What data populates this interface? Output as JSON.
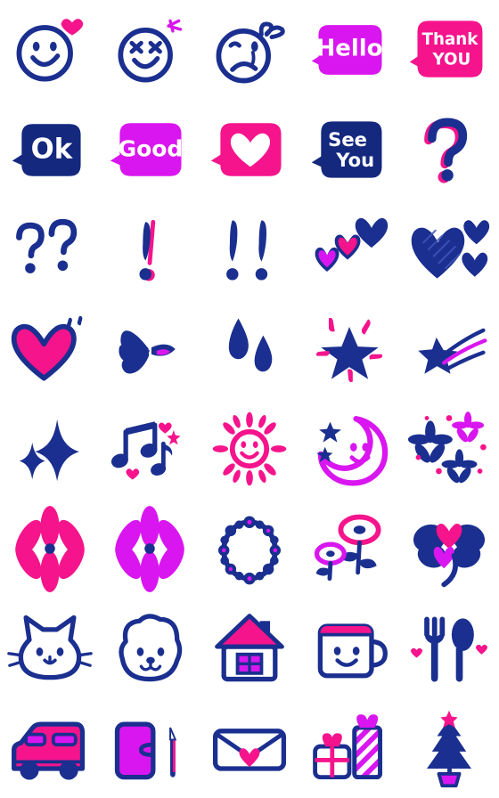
{
  "sheet": {
    "title": "Hand-drawn Emoji Sticker Sheet",
    "columns": 5,
    "rows": 8,
    "background_color": "#ffffff",
    "palette": {
      "navy": "#1a2f8f",
      "navy_dark": "#14287e",
      "magenta": "#d916ef",
      "pink": "#f5148c",
      "hot_pink": "#fa1f96",
      "white": "#ffffff"
    }
  },
  "stickers": [
    {
      "id": 1,
      "row": 1,
      "col": 1,
      "name": "smiley-face-with-heart",
      "label": "Smiley face with pink heart",
      "colors": [
        "#1a2f8f",
        "#f5148c"
      ],
      "text": ""
    },
    {
      "id": 2,
      "row": 1,
      "col": 2,
      "name": "happy-squint-face",
      "label": "Happy squinting face with sparkle",
      "colors": [
        "#1a2f8f",
        "#d916ef"
      ],
      "text": ""
    },
    {
      "id": 3,
      "row": 1,
      "col": 3,
      "name": "sad-face-with-bow",
      "label": "Sad crying face with bow",
      "colors": [
        "#1a2f8f"
      ],
      "text": ""
    },
    {
      "id": 4,
      "row": 1,
      "col": 4,
      "name": "speech-bubble-hello",
      "label": "Magenta speech bubble",
      "colors": [
        "#d916ef",
        "#ffffff"
      ],
      "text": "Hello"
    },
    {
      "id": 5,
      "row": 1,
      "col": 5,
      "name": "speech-bubble-thank-you",
      "label": "Pink speech bubble two lines",
      "colors": [
        "#f5148c",
        "#ffffff"
      ],
      "text": "Thank|YOU"
    },
    {
      "id": 6,
      "row": 2,
      "col": 1,
      "name": "speech-bubble-ok",
      "label": "Navy speech bubble",
      "colors": [
        "#14287e",
        "#ffffff"
      ],
      "text": "Ok"
    },
    {
      "id": 7,
      "row": 2,
      "col": 2,
      "name": "speech-bubble-good",
      "label": "Magenta speech bubble",
      "colors": [
        "#d916ef",
        "#ffffff"
      ],
      "text": "Good"
    },
    {
      "id": 8,
      "row": 2,
      "col": 3,
      "name": "speech-bubble-heart",
      "label": "Pink speech bubble with white heart",
      "colors": [
        "#f5148c",
        "#ffffff"
      ],
      "text": ""
    },
    {
      "id": 9,
      "row": 2,
      "col": 4,
      "name": "speech-bubble-see-you",
      "label": "Navy speech bubble two lines",
      "colors": [
        "#14287e",
        "#ffffff"
      ],
      "text": "See|You"
    },
    {
      "id": 10,
      "row": 2,
      "col": 5,
      "name": "question-mark",
      "label": "Question mark with pink shadow",
      "colors": [
        "#1a2f8f",
        "#f5148c"
      ],
      "text": "?"
    },
    {
      "id": 11,
      "row": 3,
      "col": 1,
      "name": "double-question-mark",
      "label": "Two question marks",
      "colors": [
        "#1a2f8f"
      ],
      "text": "??"
    },
    {
      "id": 12,
      "row": 3,
      "col": 2,
      "name": "exclamation-mark",
      "label": "Single exclamation mark",
      "colors": [
        "#1a2f8f",
        "#f5148c"
      ],
      "text": "!"
    },
    {
      "id": 13,
      "row": 3,
      "col": 3,
      "name": "double-exclamation-mark",
      "label": "Two exclamation marks",
      "colors": [
        "#1a2f8f"
      ],
      "text": "!!"
    },
    {
      "id": 14,
      "row": 3,
      "col": 4,
      "name": "three-ascending-hearts",
      "label": "Three hearts ascending",
      "colors": [
        "#1a2f8f",
        "#d916ef",
        "#f5148c"
      ],
      "text": ""
    },
    {
      "id": 15,
      "row": 3,
      "col": 5,
      "name": "striped-heart-trio",
      "label": "Large striped heart with two small",
      "colors": [
        "#1a2f8f"
      ],
      "text": ""
    },
    {
      "id": 16,
      "row": 4,
      "col": 1,
      "name": "pink-heart-outlined",
      "label": "Pink heart with navy outline",
      "colors": [
        "#1a2f8f",
        "#f5148c"
      ],
      "text": ""
    },
    {
      "id": 17,
      "row": 4,
      "col": 2,
      "name": "broken-heart",
      "label": "Broken heart",
      "colors": [
        "#1a2f8f",
        "#d916ef"
      ],
      "text": ""
    },
    {
      "id": 18,
      "row": 4,
      "col": 3,
      "name": "sweat-drops",
      "label": "Two sweat drops",
      "colors": [
        "#1a2f8f"
      ],
      "text": ""
    },
    {
      "id": 19,
      "row": 4,
      "col": 4,
      "name": "star-burst",
      "label": "Navy star with pink burst rays",
      "colors": [
        "#1a2f8f",
        "#f5148c"
      ],
      "text": ""
    },
    {
      "id": 20,
      "row": 4,
      "col": 5,
      "name": "shooting-star",
      "label": "Shooting star with trail",
      "colors": [
        "#1a2f8f",
        "#d916ef"
      ],
      "text": ""
    },
    {
      "id": 21,
      "row": 5,
      "col": 1,
      "name": "sparkles",
      "label": "Two four-point sparkles",
      "colors": [
        "#1a2f8f"
      ],
      "text": ""
    },
    {
      "id": 22,
      "row": 5,
      "col": 2,
      "name": "music-notes",
      "label": "Music notes with pink hearts",
      "colors": [
        "#1a2f8f",
        "#f5148c"
      ],
      "text": ""
    },
    {
      "id": 23,
      "row": 5,
      "col": 3,
      "name": "smiling-sun",
      "label": "Pink smiling sun with rays",
      "colors": [
        "#f5148c"
      ],
      "text": ""
    },
    {
      "id": 24,
      "row": 5,
      "col": 4,
      "name": "crescent-moon-with-stars",
      "label": "Magenta smiling crescent moon",
      "colors": [
        "#d916ef",
        "#1a2f8f"
      ],
      "text": ""
    },
    {
      "id": 25,
      "row": 5,
      "col": 5,
      "name": "flower-cluster",
      "label": "Cluster of small flowers",
      "colors": [
        "#1a2f8f",
        "#f5148c"
      ],
      "text": ""
    },
    {
      "id": 26,
      "row": 6,
      "col": 1,
      "name": "pink-flower",
      "label": "Pink six-petal flower",
      "colors": [
        "#f5148c",
        "#1a2f8f"
      ],
      "text": ""
    },
    {
      "id": 27,
      "row": 6,
      "col": 2,
      "name": "magenta-flower",
      "label": "Magenta six-petal flower",
      "colors": [
        "#d916ef",
        "#1a2f8f"
      ],
      "text": ""
    },
    {
      "id": 28,
      "row": 6,
      "col": 3,
      "name": "flower-wreath",
      "label": "Navy flower wreath ring",
      "colors": [
        "#1a2f8f"
      ],
      "text": ""
    },
    {
      "id": 29,
      "row": 6,
      "col": 4,
      "name": "tulip-flowers",
      "label": "Two outlined flowers",
      "colors": [
        "#1a2f8f",
        "#f5148c",
        "#d916ef"
      ],
      "text": ""
    },
    {
      "id": 30,
      "row": 6,
      "col": 5,
      "name": "four-leaf-clover",
      "label": "Clover with heart petals",
      "colors": [
        "#1a2f8f",
        "#f5148c",
        "#d916ef"
      ],
      "text": ""
    },
    {
      "id": 31,
      "row": 7,
      "col": 1,
      "name": "cat-face",
      "label": "White cat face",
      "colors": [
        "#1a2f8f",
        "#ffffff"
      ],
      "text": ""
    },
    {
      "id": 32,
      "row": 7,
      "col": 2,
      "name": "dog-face",
      "label": "White dog face",
      "colors": [
        "#1a2f8f",
        "#ffffff"
      ],
      "text": ""
    },
    {
      "id": 33,
      "row": 7,
      "col": 3,
      "name": "house",
      "label": "House with pink roof",
      "colors": [
        "#1a2f8f",
        "#f5148c",
        "#d916ef"
      ],
      "text": ""
    },
    {
      "id": 34,
      "row": 7,
      "col": 4,
      "name": "smiling-mug",
      "label": "Mug with smiling face",
      "colors": [
        "#1a2f8f",
        "#f5148c",
        "#ffffff"
      ],
      "text": ""
    },
    {
      "id": 35,
      "row": 7,
      "col": 5,
      "name": "fork-and-spoon",
      "label": "Fork and spoon with hearts",
      "colors": [
        "#1a2f8f",
        "#f5148c"
      ],
      "text": ""
    },
    {
      "id": 36,
      "row": 8,
      "col": 1,
      "name": "pink-car",
      "label": "Pink car with navy wheels",
      "colors": [
        "#f5148c",
        "#1a2f8f"
      ],
      "text": ""
    },
    {
      "id": 37,
      "row": 8,
      "col": 2,
      "name": "notebook-and-pen",
      "label": "Magenta notebook and pen",
      "colors": [
        "#d916ef",
        "#1a2f8f",
        "#f5148c"
      ],
      "text": ""
    },
    {
      "id": 38,
      "row": 8,
      "col": 3,
      "name": "envelope-with-heart",
      "label": "White envelope with pink heart",
      "colors": [
        "#1a2f8f",
        "#f5148c",
        "#ffffff"
      ],
      "text": ""
    },
    {
      "id": 39,
      "row": 8,
      "col": 4,
      "name": "gift-boxes",
      "label": "Two wrapped gift boxes",
      "colors": [
        "#1a2f8f",
        "#f5148c",
        "#d916ef"
      ],
      "text": ""
    },
    {
      "id": 40,
      "row": 8,
      "col": 5,
      "name": "christmas-tree",
      "label": "Navy tree in magenta pot",
      "colors": [
        "#1a2f8f",
        "#f5148c",
        "#d916ef"
      ],
      "text": ""
    }
  ],
  "bubble_labels": {
    "hello": "Hello",
    "thank": "Thank",
    "you_caps": "YOU",
    "ok": "Ok",
    "good": "Good",
    "see": "See",
    "you": "You",
    "question": "?",
    "double_question": "??",
    "exclamation": "!",
    "double_exclamation": "!!"
  }
}
